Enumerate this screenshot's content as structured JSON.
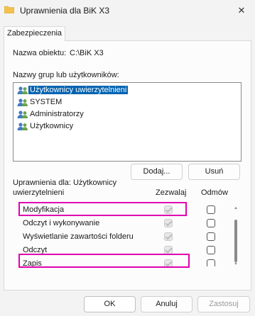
{
  "window": {
    "title": "Uprawnienia dla BiK X3",
    "close_glyph": "✕"
  },
  "tabs": [
    {
      "label": "Zabezpieczenia"
    }
  ],
  "object": {
    "label": "Nazwa obiektu:",
    "value": "C:\\BiK X3"
  },
  "groups": {
    "label": "Nazwy grup lub użytkowników:",
    "items": [
      {
        "label": "Użytkownicy uwierzytelnieni",
        "icon": "users-icon",
        "selected": true
      },
      {
        "label": "SYSTEM",
        "icon": "users-icon",
        "selected": false
      },
      {
        "label": "Administratorzy",
        "icon": "users-icon",
        "selected": false
      },
      {
        "label": "Użytkownicy",
        "icon": "users-icon",
        "selected": false
      }
    ]
  },
  "buttons": {
    "add": "Dodaj...",
    "remove": "Usuń",
    "ok": "OK",
    "cancel": "Anuluj",
    "apply": "Zastosuj"
  },
  "permissions": {
    "label_line1": "Uprawnienia dla: Użytkownicy",
    "label_line2": "uwierzytelnieni",
    "col_allow": "Zezwalaj",
    "col_deny": "Odmów",
    "rows": [
      {
        "name": "Modyfikacja",
        "allow": true,
        "deny": false,
        "highlighted": true
      },
      {
        "name": "Odczyt i wykonywanie",
        "allow": true,
        "deny": false,
        "highlighted": false
      },
      {
        "name": "Wyświetlanie zawartości folderu",
        "allow": true,
        "deny": false,
        "highlighted": false
      },
      {
        "name": "Odczyt",
        "allow": true,
        "deny": false,
        "highlighted": false
      },
      {
        "name": "Zapis",
        "allow": true,
        "deny": false,
        "highlighted": true
      }
    ]
  },
  "colors": {
    "highlight": "#e000b0",
    "selection": "#0063b1",
    "folder": "#f2c14e"
  }
}
